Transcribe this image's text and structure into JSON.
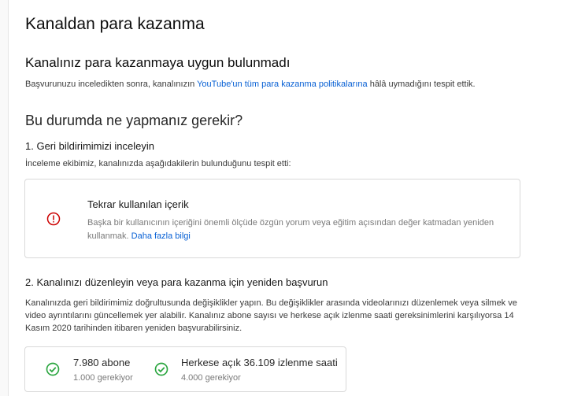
{
  "page": {
    "title": "Kanaldan para kazanma"
  },
  "status": {
    "heading": "Kanalınız para kazanmaya uygun bulunmadı",
    "text_before": "Başvurunuzu inceledikten sonra, kanalınızın ",
    "policy_link": "YouTube'un tüm para kazanma politikalarına",
    "text_after": " hâlâ uymadığını tespit ettik."
  },
  "next_steps": {
    "heading": "Bu durumda ne yapmanız gerekir?",
    "step1": {
      "title": "1. Geri bildirimimizi inceleyin",
      "description": "İnceleme ekibimiz, kanalınızda aşağıdakilerin bulunduğunu tespit etti:",
      "issue": {
        "icon": "error-icon",
        "title": "Tekrar kullanılan içerik",
        "description": "Başka bir kullanıcının içeriğini önemli ölçüde özgün yorum veya eğitim açısından değer katmadan yeniden kullanmak.",
        "learn_more": "Daha fazla bilgi"
      }
    },
    "step2": {
      "title": "2. Kanalınızı düzenleyin veya para kazanma için yeniden başvurun",
      "description": "Kanalınızda geri bildirimimiz doğrultusunda değişiklikler yapın. Bu değişiklikler arasında videolarınızı düzenlemek veya silmek ve video ayrıntılarını güncellemek yer alabilir. Kanalınız abone sayısı ve herkese açık izlenme saati gereksinimlerini karşılıyorsa 14 Kasım 2020 tarihinden itibaren yeniden başvurabilirsiniz."
    }
  },
  "requirements": [
    {
      "icon": "check-circle-icon",
      "value": "7.980 abone",
      "required": "1.000 gerekiyor"
    },
    {
      "icon": "check-circle-icon",
      "value": "Herkese açık 36.109 izlenme saati",
      "required": "4.000 gerekiyor"
    }
  ],
  "colors": {
    "link": "#065fd4",
    "error": "#cc0000",
    "success": "#2ba640"
  }
}
